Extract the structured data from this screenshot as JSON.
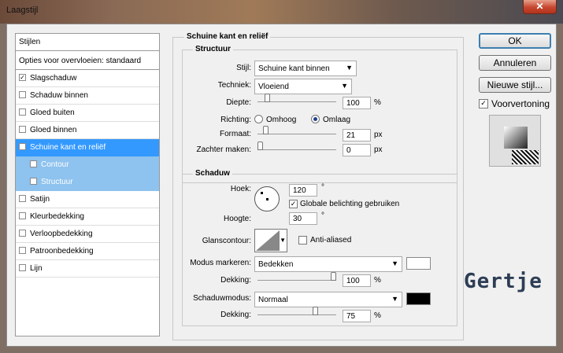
{
  "window": {
    "title": "Laagstijl",
    "close_glyph": "✕"
  },
  "stylelist": {
    "header": "Stijlen",
    "blend_options": "Opties voor overvloeien: standaard",
    "items": [
      {
        "label": "Slagschaduw",
        "checked": "✓"
      },
      {
        "label": "Schaduw binnen",
        "checked": ""
      },
      {
        "label": "Gloed buiten",
        "checked": ""
      },
      {
        "label": "Gloed binnen",
        "checked": ""
      },
      {
        "label": "Schuine kant en reliëf",
        "checked": "✓"
      },
      {
        "label": "Contour",
        "checked": ""
      },
      {
        "label": "Structuur",
        "checked": ""
      },
      {
        "label": "Satijn",
        "checked": ""
      },
      {
        "label": "Kleurbedekking",
        "checked": ""
      },
      {
        "label": "Verloopbedekking",
        "checked": ""
      },
      {
        "label": "Patroonbedekking",
        "checked": ""
      },
      {
        "label": "Lijn",
        "checked": ""
      }
    ]
  },
  "panel": {
    "title": "Schuine kant en reliëf",
    "structure": {
      "title": "Structuur",
      "style_label": "Stijl:",
      "style_value": "Schuine kant binnen",
      "technique_label": "Techniek:",
      "technique_value": "Vloeiend",
      "depth_label": "Diepte:",
      "depth_value": "100",
      "depth_unit": "%",
      "depth_level": 0.1,
      "direction_label": "Richting:",
      "dir_up": "Omhoog",
      "dir_down": "Omlaag",
      "size_label": "Formaat:",
      "size_value": "21",
      "size_unit": "px",
      "size_level": 0.08,
      "soften_label": "Zachter maken:",
      "soften_value": "0",
      "soften_unit": "px",
      "soften_level": 0.0
    },
    "shading": {
      "title": "Schaduw",
      "angle_label": "Hoek:",
      "angle_value": "120",
      "angle_unit": "°",
      "global_light_label": "Globale belichting gebruiken",
      "global_light_checked": "✓",
      "altitude_label": "Hoogte:",
      "altitude_value": "30",
      "altitude_unit": "°",
      "gloss_label": "Glanscontour:",
      "antialias_label": "Anti-aliased",
      "highlight_mode_label": "Modus markeren:",
      "highlight_mode_value": "Bedekken",
      "highlight_color": "#ffffff",
      "highlight_opacity_label": "Dekking:",
      "highlight_opacity_value": "100",
      "highlight_opacity_unit": "%",
      "highlight_opacity_level": 1.0,
      "shadow_mode_label": "Schaduwmodus:",
      "shadow_mode_value": "Normaal",
      "shadow_color": "#000000",
      "shadow_opacity_label": "Dekking:",
      "shadow_opacity_value": "75",
      "shadow_opacity_unit": "%",
      "shadow_opacity_level": 0.75
    }
  },
  "buttons": {
    "ok": "OK",
    "cancel": "Annuleren",
    "new_style": "Nieuwe stijl...",
    "preview_label": "Voorvertoning",
    "preview_checked": "✓"
  },
  "watermark": "Gertje"
}
